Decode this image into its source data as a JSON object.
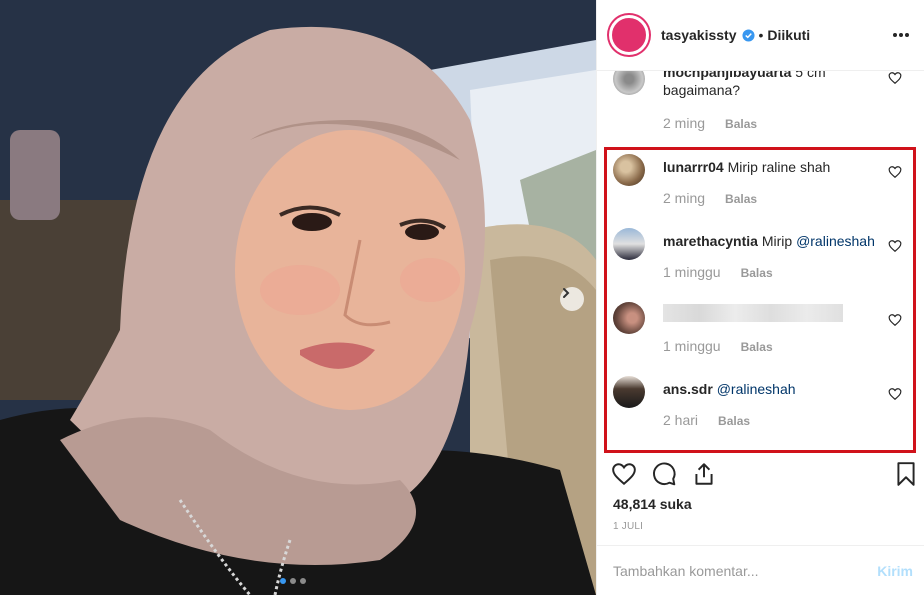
{
  "header": {
    "username": "tasyakissty",
    "separator": "•",
    "follow_status": "Diikuti",
    "avatar_color": "#e1306c",
    "verified_color": "#3897f0"
  },
  "comments": [
    {
      "username": "mochpanjibayuarta",
      "text": "5 cm bagaimana?",
      "time": "2 ming",
      "reply": "Balas"
    },
    {
      "username": "lunarrr04",
      "text": "Mirip raline shah",
      "time": "2 ming",
      "reply": "Balas"
    },
    {
      "username": "marethacyntia",
      "text": "Mirip",
      "mention": "@ralineshah",
      "time": "1 minggu",
      "reply": "Balas"
    },
    {
      "username": "",
      "text": "",
      "time": "1 minggu",
      "reply": "Balas"
    },
    {
      "username": "ans.sdr",
      "text": "",
      "mention": "@ralineshah",
      "time": "2 hari",
      "reply": "Balas"
    }
  ],
  "highlight_color": "#d0121a",
  "likes": "48,814 suka",
  "date": "1 JULI",
  "comment_input": {
    "placeholder": "Tambahkan komentar...",
    "post_label": "Kirim"
  },
  "icons": {
    "heart": "heart-icon",
    "comment": "comment-icon",
    "share": "share-icon",
    "bookmark": "bookmark-icon",
    "more": "more-options-icon",
    "next": "chevron-right-icon",
    "verified": "verified-badge-icon"
  },
  "carousel": {
    "slides": 3,
    "active": 1
  }
}
